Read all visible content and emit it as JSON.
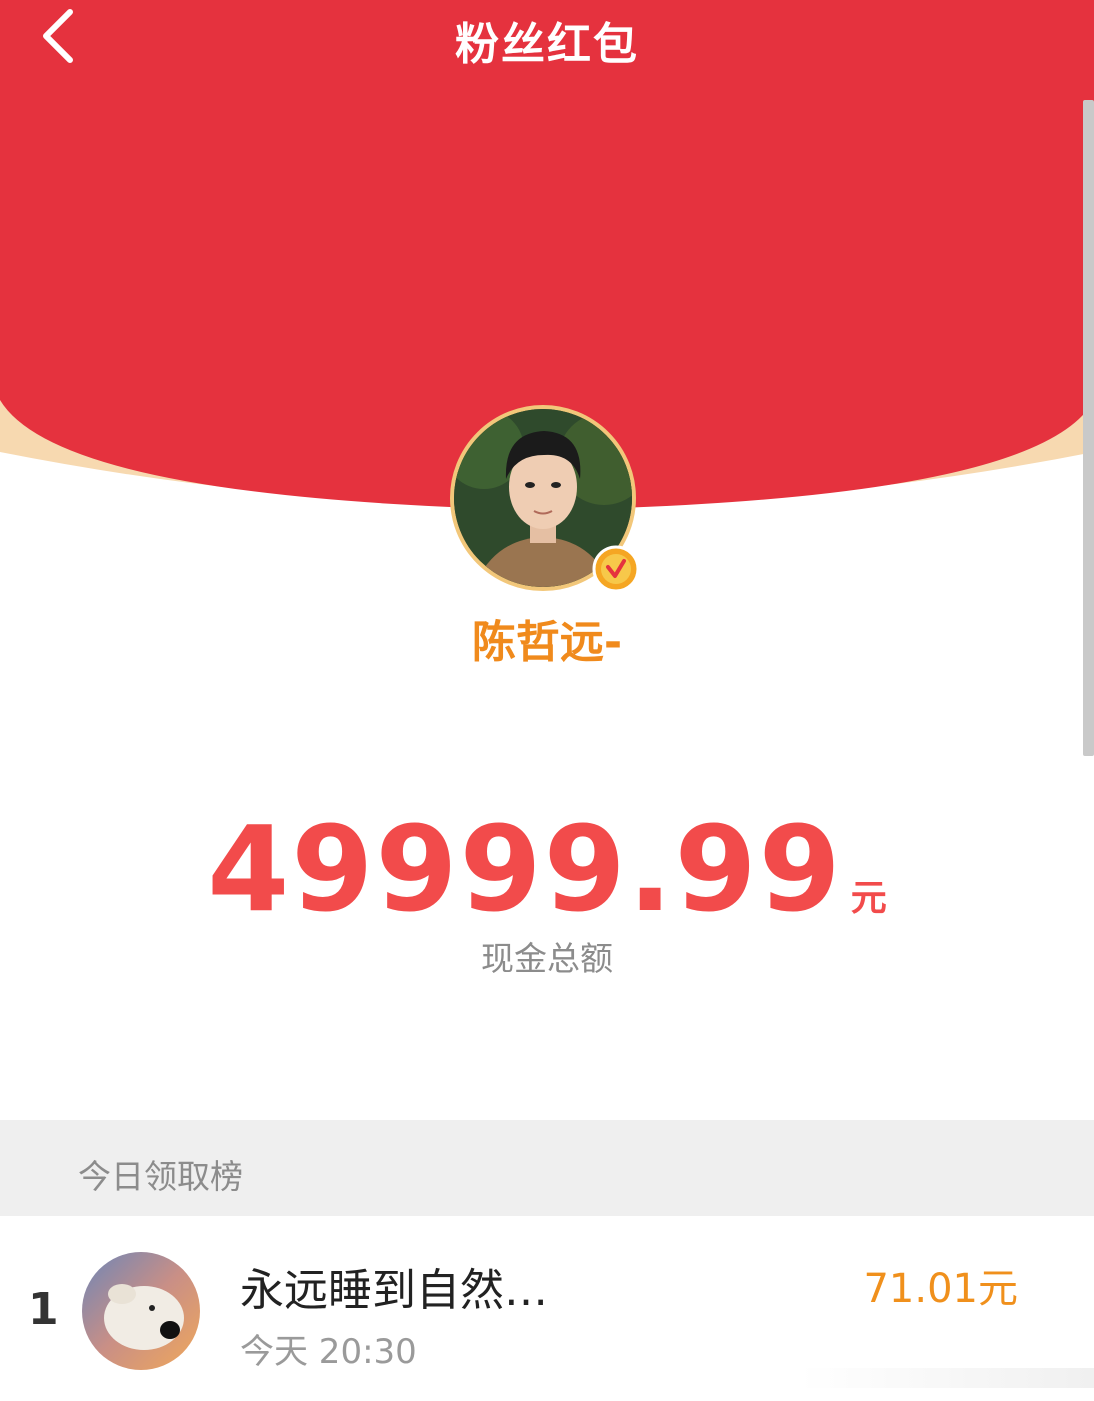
{
  "header": {
    "title": "粉丝红包",
    "back_icon": "chevron-left-icon"
  },
  "colors": {
    "primary_red": "#e5323e",
    "rim_cream": "#f7d9b0",
    "username_orange": "#f08a1c",
    "amount_red": "#f24b4b",
    "rank_amount_orange": "#f0901c"
  },
  "profile": {
    "username": "陈哲远-",
    "verified_icon": "verified-badge-icon"
  },
  "cash": {
    "amount": "49999.99",
    "currency": "元",
    "label": "现金总额"
  },
  "ranking": {
    "title": "今日领取榜",
    "rows": [
      {
        "rank": "1",
        "name": "永远睡到自然…",
        "time": "今天 20:30",
        "amount": "71.01元"
      }
    ]
  }
}
